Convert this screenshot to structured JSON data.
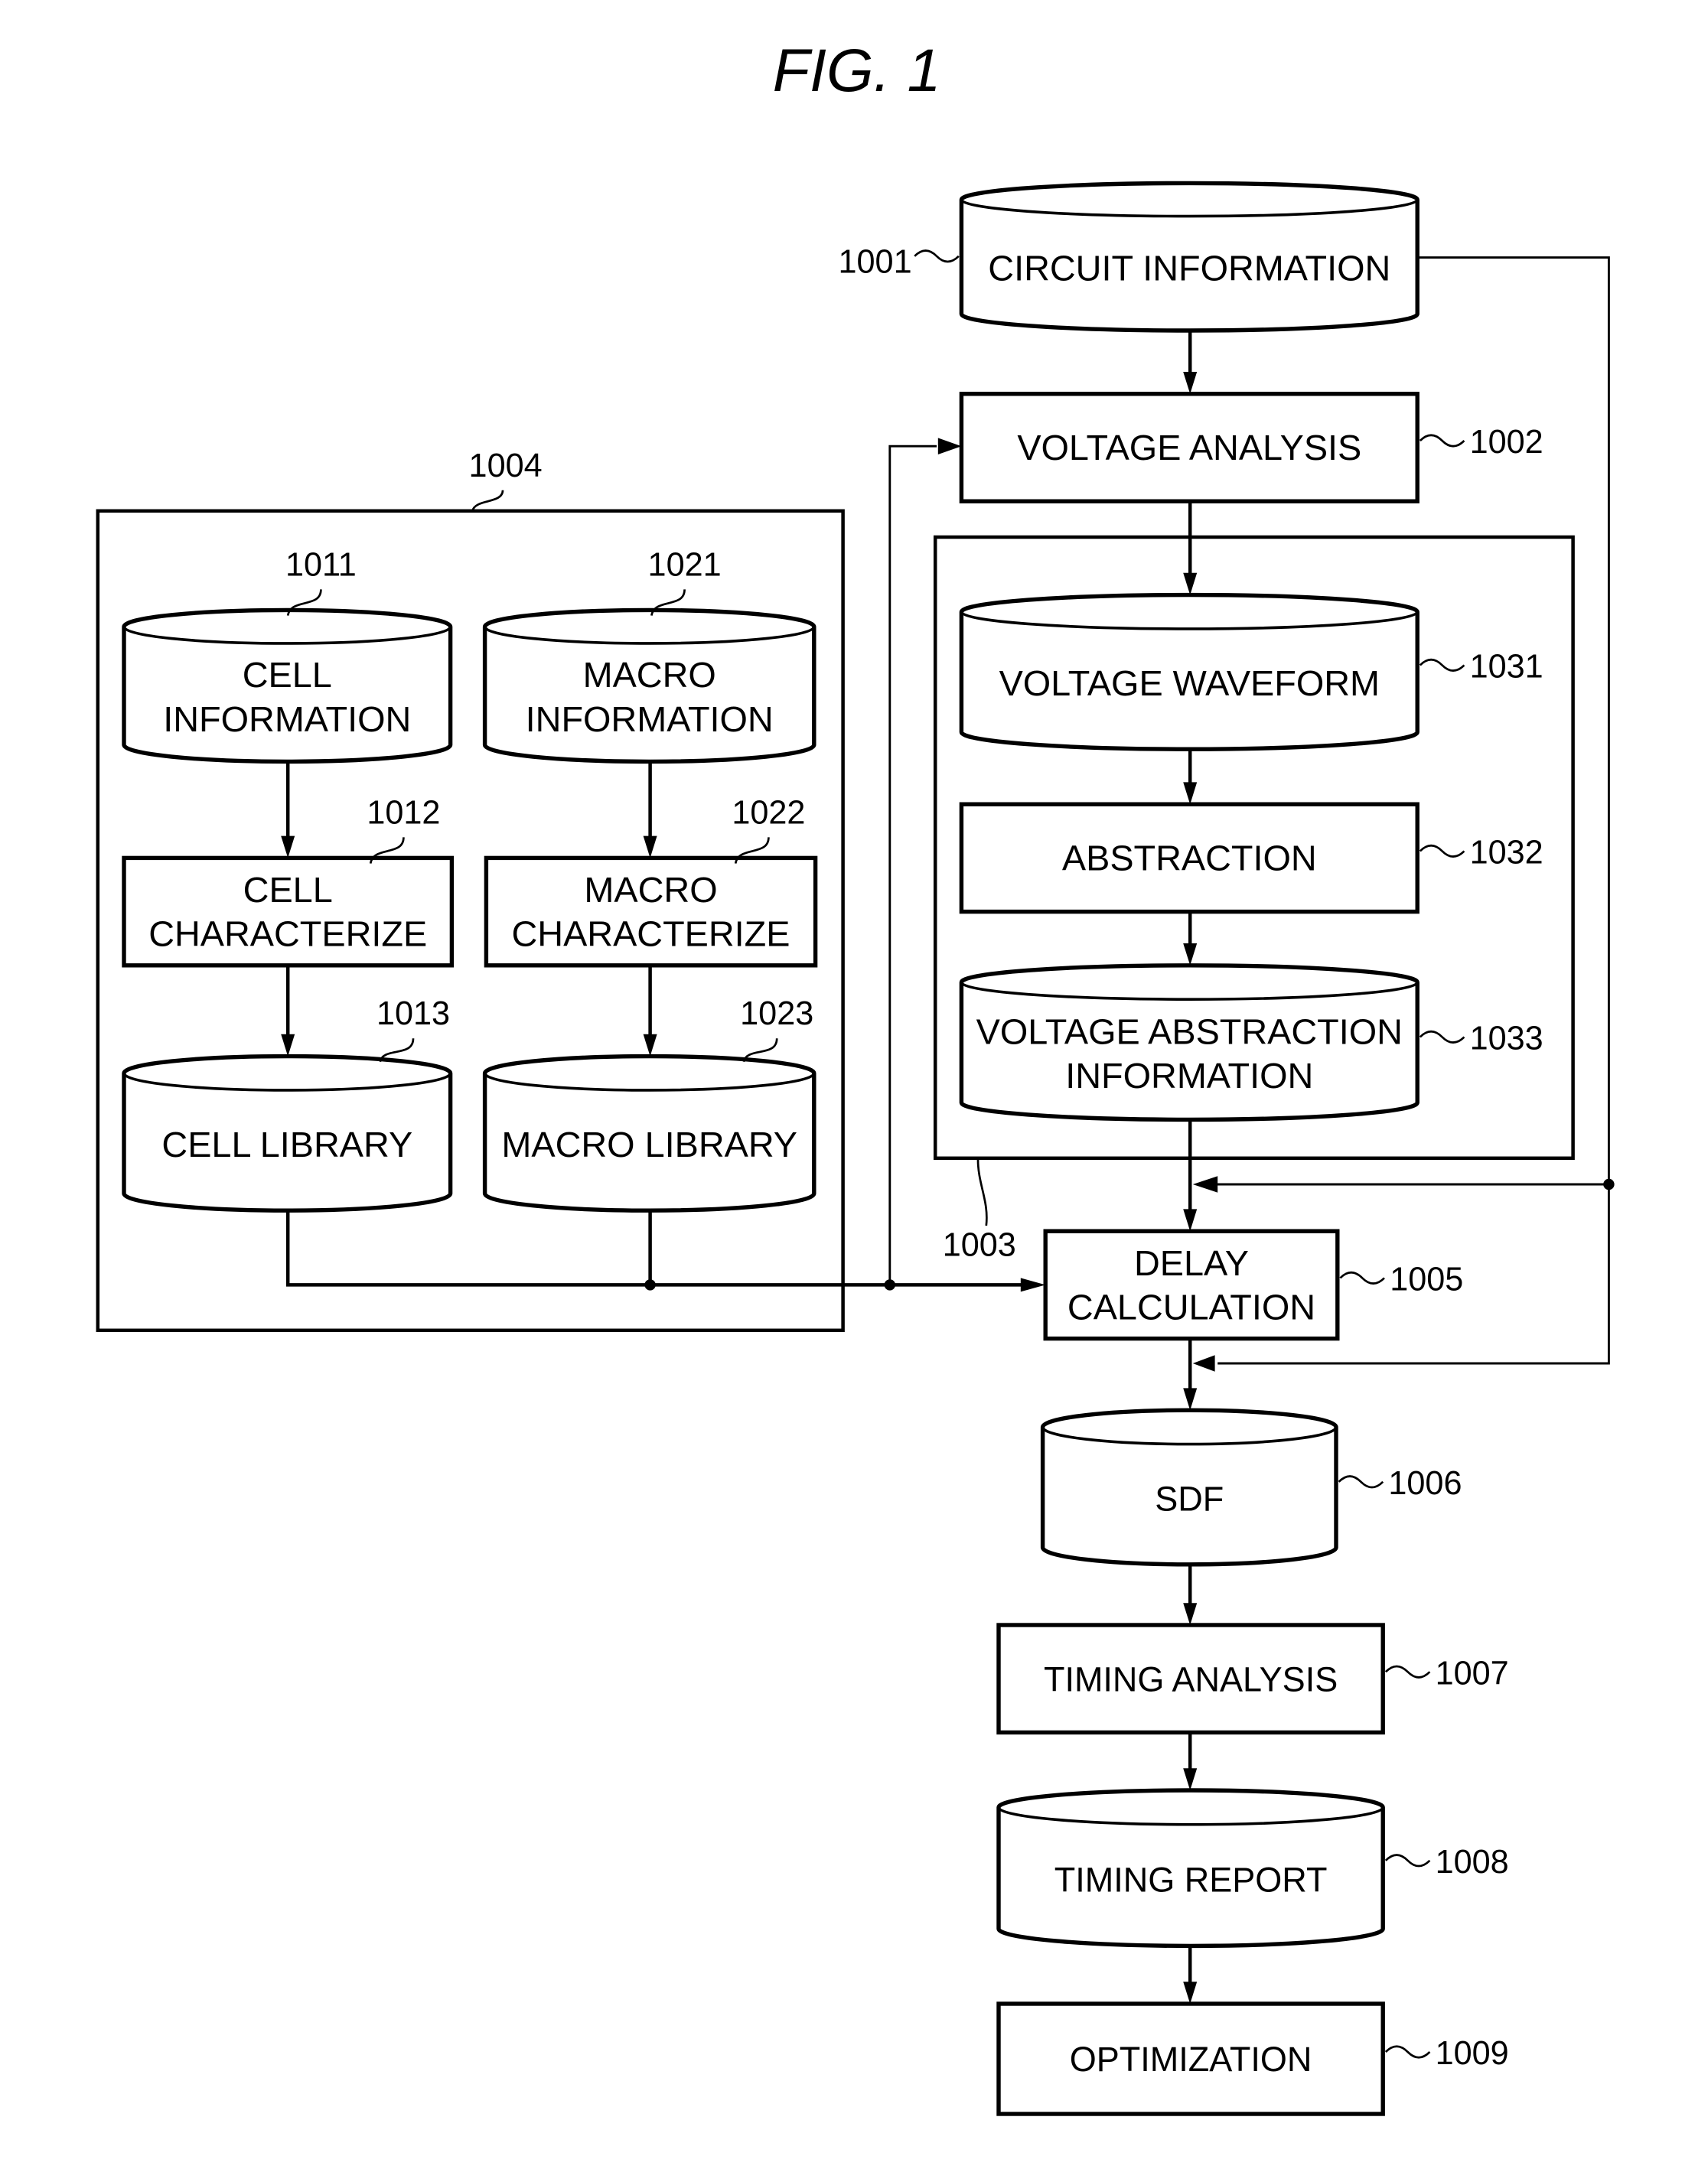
{
  "figure": {
    "title": "FIG. 1"
  },
  "nodes": {
    "circuit_information": {
      "label": [
        "CIRCUIT INFORMATION"
      ],
      "ref": "1001",
      "kind": "database"
    },
    "voltage_analysis": {
      "label": [
        "VOLTAGE ANALYSIS"
      ],
      "ref": "1002",
      "kind": "process"
    },
    "voltage_waveform": {
      "label": [
        "VOLTAGE WAVEFORM"
      ],
      "ref": "1031",
      "kind": "database"
    },
    "abstraction": {
      "label": [
        "ABSTRACTION"
      ],
      "ref": "1032",
      "kind": "process"
    },
    "voltage_abstraction_information": {
      "label": [
        "VOLTAGE ABSTRACTION",
        "INFORMATION"
      ],
      "ref": "1033",
      "kind": "database"
    },
    "cell_information": {
      "label": [
        "CELL",
        "INFORMATION"
      ],
      "ref": "1011",
      "kind": "database"
    },
    "cell_characterize": {
      "label": [
        "CELL",
        "CHARACTERIZE"
      ],
      "ref": "1012",
      "kind": "process"
    },
    "cell_library": {
      "label": [
        "CELL LIBRARY"
      ],
      "ref": "1013",
      "kind": "database"
    },
    "macro_information": {
      "label": [
        "MACRO",
        "INFORMATION"
      ],
      "ref": "1021",
      "kind": "database"
    },
    "macro_characterize": {
      "label": [
        "MACRO",
        "CHARACTERIZE"
      ],
      "ref": "1022",
      "kind": "process"
    },
    "macro_library": {
      "label": [
        "MACRO LIBRARY"
      ],
      "ref": "1023",
      "kind": "database"
    },
    "delay_calculation": {
      "label": [
        "DELAY",
        "CALCULATION"
      ],
      "ref": "1005",
      "kind": "process"
    },
    "sdf": {
      "label": [
        "SDF"
      ],
      "ref": "1006",
      "kind": "database"
    },
    "timing_analysis": {
      "label": [
        "TIMING ANALYSIS"
      ],
      "ref": "1007",
      "kind": "process"
    },
    "timing_report": {
      "label": [
        "TIMING REPORT"
      ],
      "ref": "1008",
      "kind": "database"
    },
    "optimization": {
      "label": [
        "OPTIMIZATION"
      ],
      "ref": "1009",
      "kind": "process"
    }
  },
  "groups": {
    "voltage_abstraction_group": {
      "ref": "1003"
    },
    "library_generation_group": {
      "ref": "1004"
    }
  },
  "edges": [
    {
      "from": "circuit_information",
      "to": "voltage_analysis"
    },
    {
      "from": "voltage_analysis",
      "to": "voltage_waveform"
    },
    {
      "from": "voltage_waveform",
      "to": "abstraction"
    },
    {
      "from": "abstraction",
      "to": "voltage_abstraction_information"
    },
    {
      "from": "voltage_abstraction_information",
      "to": "delay_calculation"
    },
    {
      "from": "cell_information",
      "to": "cell_characterize"
    },
    {
      "from": "cell_characterize",
      "to": "cell_library"
    },
    {
      "from": "macro_information",
      "to": "macro_characterize"
    },
    {
      "from": "macro_characterize",
      "to": "macro_library"
    },
    {
      "from": "cell_library",
      "to": "delay_calculation"
    },
    {
      "from": "macro_library",
      "to": "delay_calculation"
    },
    {
      "from": "cell_library",
      "to": "voltage_analysis"
    },
    {
      "from": "circuit_information",
      "to": "delay_calculation"
    },
    {
      "from": "circuit_information",
      "to": "sdf"
    },
    {
      "from": "delay_calculation",
      "to": "sdf"
    },
    {
      "from": "sdf",
      "to": "timing_analysis"
    },
    {
      "from": "timing_analysis",
      "to": "timing_report"
    },
    {
      "from": "timing_report",
      "to": "optimization"
    }
  ]
}
